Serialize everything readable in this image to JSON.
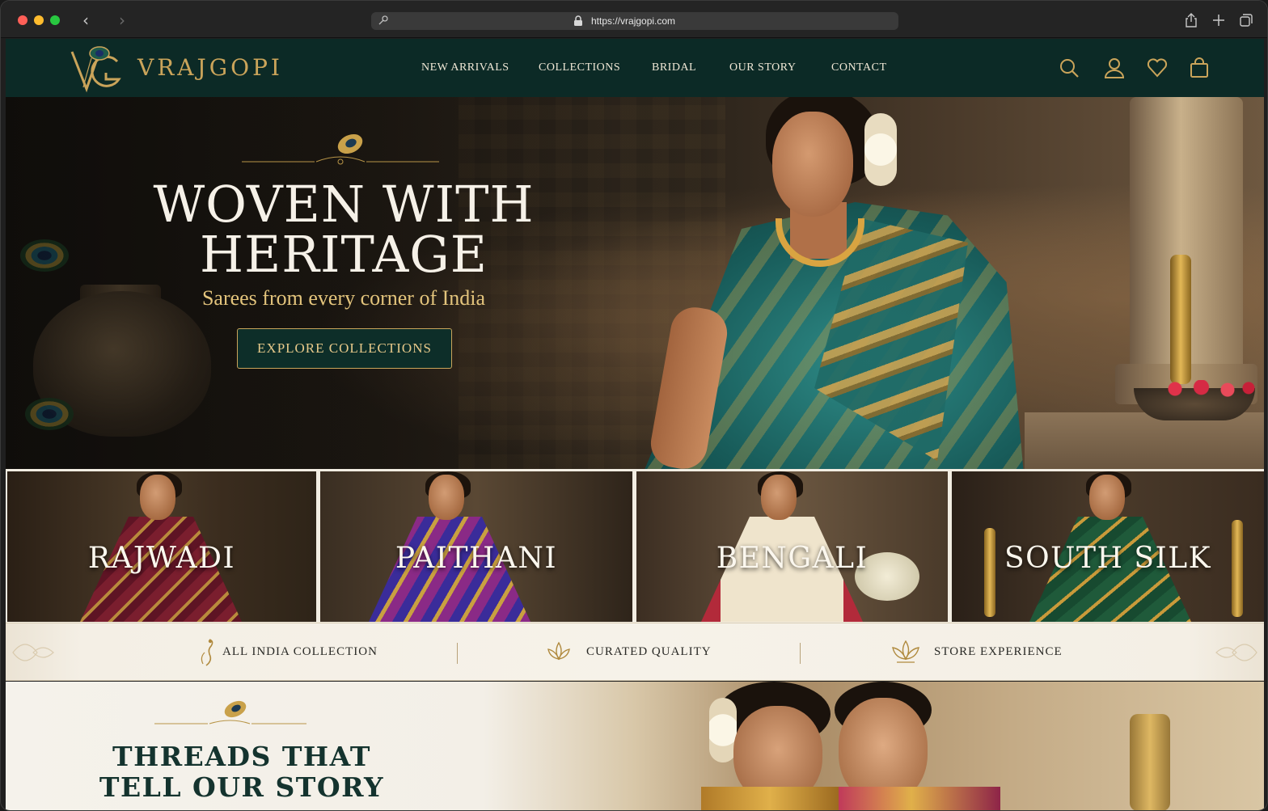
{
  "browser": {
    "url": "https://vrajgopi.com"
  },
  "header": {
    "brand": "VRAJGOPI",
    "nav": [
      "NEW ARRIVALS",
      "COLLECTIONS",
      "BRIDAL",
      "OUR STORY",
      "CONTACT"
    ],
    "icons": [
      "search-icon",
      "account-icon",
      "wishlist-heart-icon",
      "shopping-bag-icon"
    ]
  },
  "hero": {
    "title_line1": "WOVEN WITH",
    "title_line2": "HERITAGE",
    "subtitle": "Sarees from every corner of India",
    "cta": "EXPLORE COLLECTIONS"
  },
  "categories": [
    {
      "label": "RAJWADI"
    },
    {
      "label": "PAITHANI"
    },
    {
      "label": "BENGALI"
    },
    {
      "label": "SOUTH SILK"
    }
  ],
  "features": [
    {
      "label": "ALL INDIA COLLECTION",
      "icon": "peacock-icon"
    },
    {
      "label": "CURATED QUALITY",
      "icon": "lotus-icon"
    },
    {
      "label": "STORE EXPERIENCE",
      "icon": "lotus-flower-icon"
    }
  ],
  "story": {
    "title_line1": "THREADS THAT",
    "title_line2": "TELL OUR STORY"
  },
  "colors": {
    "header_green": "#0c2a26",
    "gold": "#caa45a",
    "cream": "#f6f2e9"
  }
}
